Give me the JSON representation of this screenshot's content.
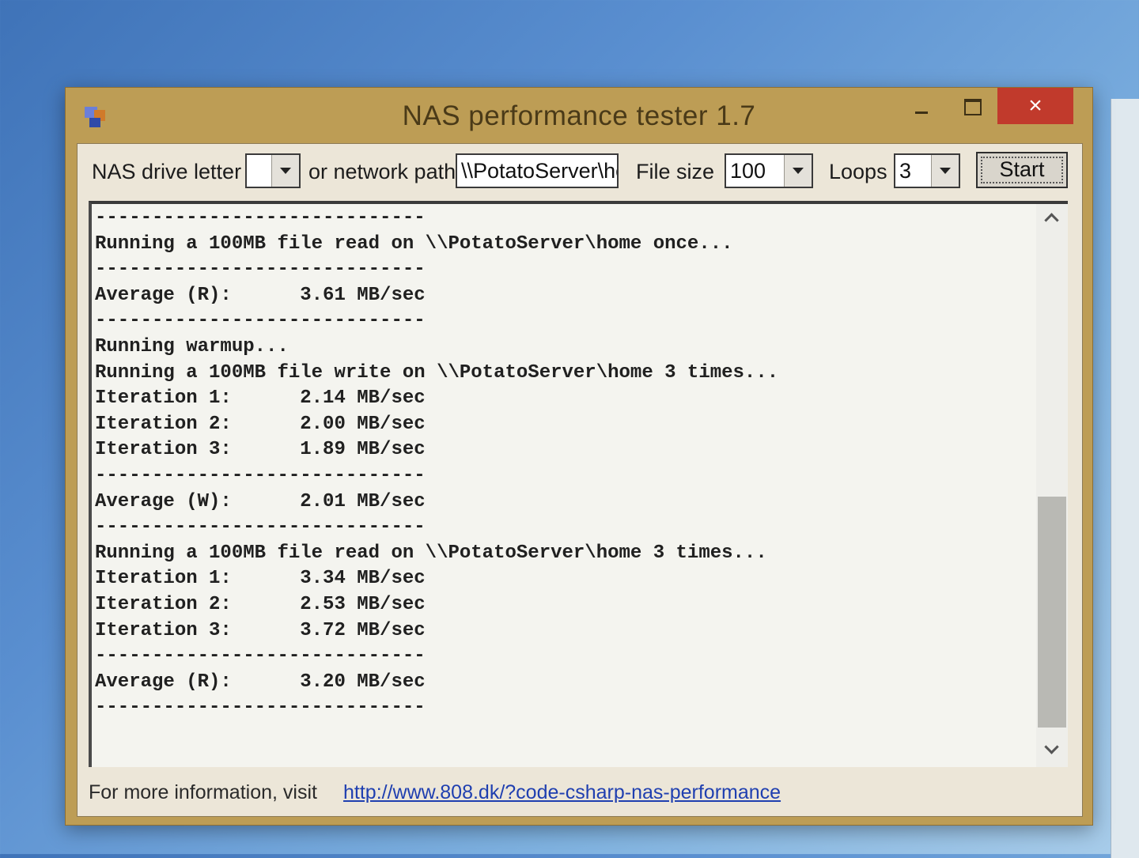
{
  "window": {
    "title": "NAS performance tester 1.7",
    "close_glyph": "×"
  },
  "toolbar": {
    "drive_letter_label": "NAS drive letter",
    "drive_letter_value": "",
    "network_path_label": "or network path",
    "network_path_value": "\\\\PotatoServer\\home",
    "file_size_label": "File size",
    "file_size_value": "100",
    "loops_label": "Loops",
    "loops_value": "3",
    "start_label": "Start"
  },
  "log": {
    "lines": [
      "-----------------------------",
      "Running a 100MB file read on \\\\PotatoServer\\home once...",
      "-----------------------------",
      "Average (R):      3.61 MB/sec",
      "-----------------------------",
      "Running warmup...",
      "Running a 100MB file write on \\\\PotatoServer\\home 3 times...",
      "Iteration 1:      2.14 MB/sec",
      "Iteration 2:      2.00 MB/sec",
      "Iteration 3:      1.89 MB/sec",
      "-----------------------------",
      "Average (W):      2.01 MB/sec",
      "-----------------------------",
      "Running a 100MB file read on \\\\PotatoServer\\home 3 times...",
      "Iteration 1:      3.34 MB/sec",
      "Iteration 2:      2.53 MB/sec",
      "Iteration 3:      3.72 MB/sec",
      "-----------------------------",
      "Average (R):      3.20 MB/sec",
      "-----------------------------"
    ]
  },
  "footer": {
    "info_text": "For more information, visit",
    "link_text": "http://www.808.dk/?code-csharp-nas-performance"
  },
  "icons": {
    "app": "app-icon",
    "minimize": "minimize-icon",
    "maximize": "maximize-icon",
    "close": "close-icon"
  },
  "colors": {
    "window_frame": "#bd9d55",
    "close_button": "#c13a2c",
    "link": "#1f3fb0"
  }
}
